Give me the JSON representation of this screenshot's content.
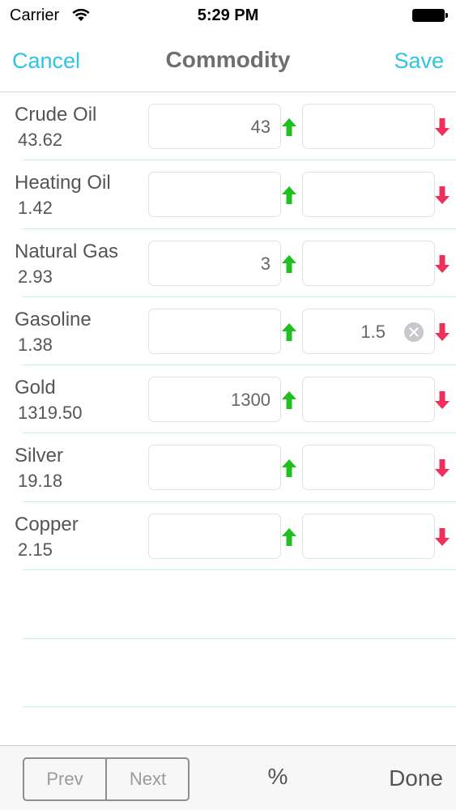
{
  "status": {
    "carrier": "Carrier",
    "time": "5:29 PM"
  },
  "nav": {
    "cancel": "Cancel",
    "title": "Commodity",
    "save": "Save"
  },
  "colors": {
    "accent": "#2ec4e6",
    "up": "#20c020",
    "down": "#f0305a"
  },
  "rows": [
    {
      "name": "Crude Oil",
      "price": "43.62",
      "high": "43",
      "low": ""
    },
    {
      "name": "Heating Oil",
      "price": "1.42",
      "high": "",
      "low": ""
    },
    {
      "name": "Natural Gas",
      "price": "2.93",
      "high": "3",
      "low": ""
    },
    {
      "name": "Gasoline",
      "price": "1.38",
      "high": "",
      "low": "1.5"
    },
    {
      "name": "Gold",
      "price": "1319.50",
      "high": "1300",
      "low": ""
    },
    {
      "name": "Silver",
      "price": "19.18",
      "high": "",
      "low": ""
    },
    {
      "name": "Copper",
      "price": "2.15",
      "high": "",
      "low": ""
    }
  ],
  "toolbar": {
    "prev": "Prev",
    "next": "Next",
    "percent": "%",
    "done": "Done"
  }
}
